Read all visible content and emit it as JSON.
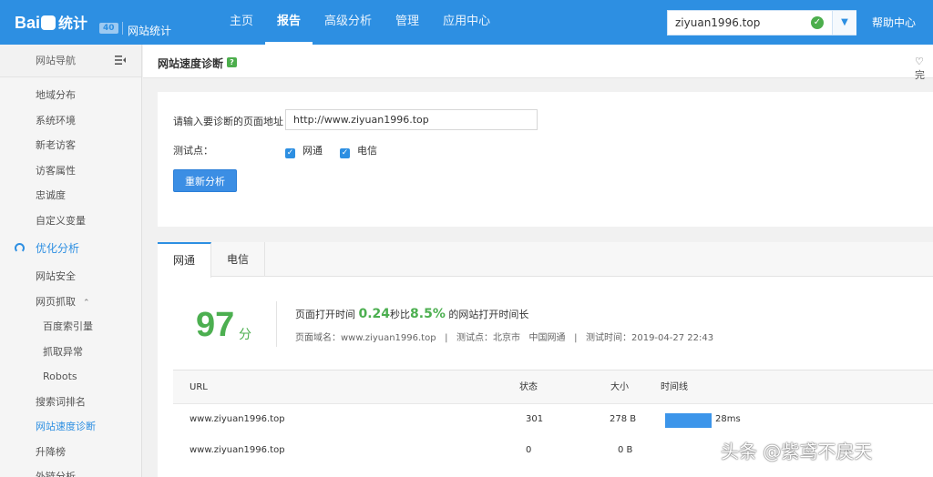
{
  "brand": {
    "logo_text": "Bai",
    "logo_text2": "统计",
    "version_badge": "40",
    "subtitle": "网站统计"
  },
  "nav": {
    "items": [
      "主页",
      "报告",
      "高级分析",
      "管理",
      "应用中心"
    ],
    "active": "报告"
  },
  "site_select": {
    "value": "ziyuan1996.top"
  },
  "help_label": "帮助中心",
  "sidebar": {
    "header": "网站导航",
    "items_top": [
      "地域分布",
      "系统环境",
      "新老访客",
      "访客属性",
      "忠诚度",
      "自定义变量"
    ],
    "group": "优化分析",
    "items_group": [
      "网站安全",
      "网页抓取"
    ],
    "sub_items": [
      "百度索引量",
      "抓取异常",
      "Robots"
    ],
    "items_bottom": [
      "搜索词排名",
      "网站速度诊断",
      "升降榜",
      "外链分析"
    ],
    "active": "网站速度诊断"
  },
  "page": {
    "title": "网站速度诊断",
    "help_icon": "?",
    "fav_label": "♡ 完"
  },
  "form": {
    "url_label": "请输入要诊断的页面地址：",
    "url_value": "http://www.ziyuan1996.top",
    "test_points_label": "测试点：",
    "options": [
      {
        "label": "网通",
        "checked": true
      },
      {
        "label": "电信",
        "checked": true
      }
    ],
    "reanalyze_button": "重新分析"
  },
  "result": {
    "tabs": [
      "网通",
      "电信"
    ],
    "active_tab": "网通",
    "score": "97",
    "score_unit": "分",
    "summary_prefix": "页面打开时间",
    "open_time": "0.24",
    "summary_middle": "秒比",
    "percent": "8.5%",
    "summary_suffix": "的网站打开时间长",
    "detail": "页面域名：www.ziyuan1996.top   |   测试点：北京市   中国网通   |   测试时间：2019-04-27 22:43"
  },
  "table": {
    "headers": {
      "url": "URL",
      "status": "状态",
      "size": "大小",
      "timeline": "时间线"
    },
    "rows": [
      {
        "url": "www.ziyuan1996.top",
        "status": "301",
        "size": "278 B",
        "time": "28ms",
        "time_fraction": 0.17
      },
      {
        "url": "www.ziyuan1996.top",
        "status": "0",
        "size": "0 B",
        "time": "",
        "time_fraction": 0
      }
    ]
  },
  "watermark": "头条 @紫鸢不戾天",
  "colors": {
    "primary": "#2d8fe2",
    "score_green": "#4caf50",
    "bar_blue": "#3c95ea"
  }
}
